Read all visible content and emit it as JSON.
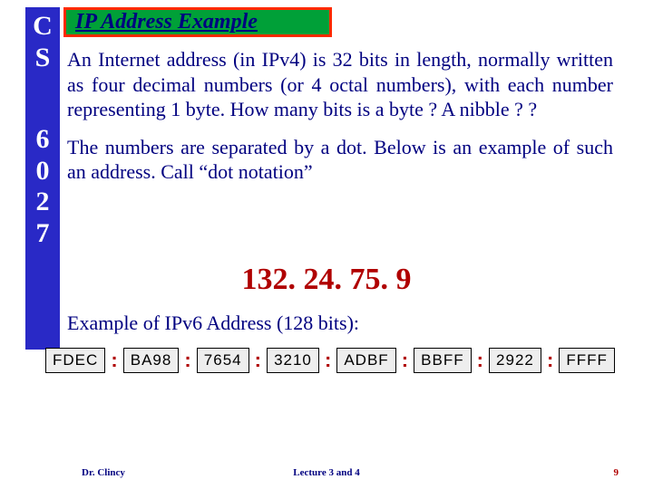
{
  "sidebar": {
    "letters": [
      "C",
      "S"
    ],
    "digits": [
      "6",
      "0",
      "2",
      "7"
    ]
  },
  "title": "IP Address Example",
  "paragraphs": {
    "p1": "An Internet address (in IPv4) is 32 bits in length, normally written as four decimal numbers (or 4 octal numbers), with each number representing 1 byte. How many bits is a byte ? A nibble ? ?",
    "p2": "The numbers are separated by a dot. Below is an example of such an address. Call “dot notation”"
  },
  "ip_example": "132. 24. 75. 9",
  "ipv6_label": "Example of IPv6 Address (128 bits):",
  "ipv6_groups": [
    "FDEC",
    "BA98",
    "7654",
    "3210",
    "ADBF",
    "BBFF",
    "2922",
    "FFFF"
  ],
  "ipv6_sep": ":",
  "footer": {
    "author": "Dr. Clincy",
    "lecture": "Lecture 3 and 4",
    "page": "9"
  }
}
